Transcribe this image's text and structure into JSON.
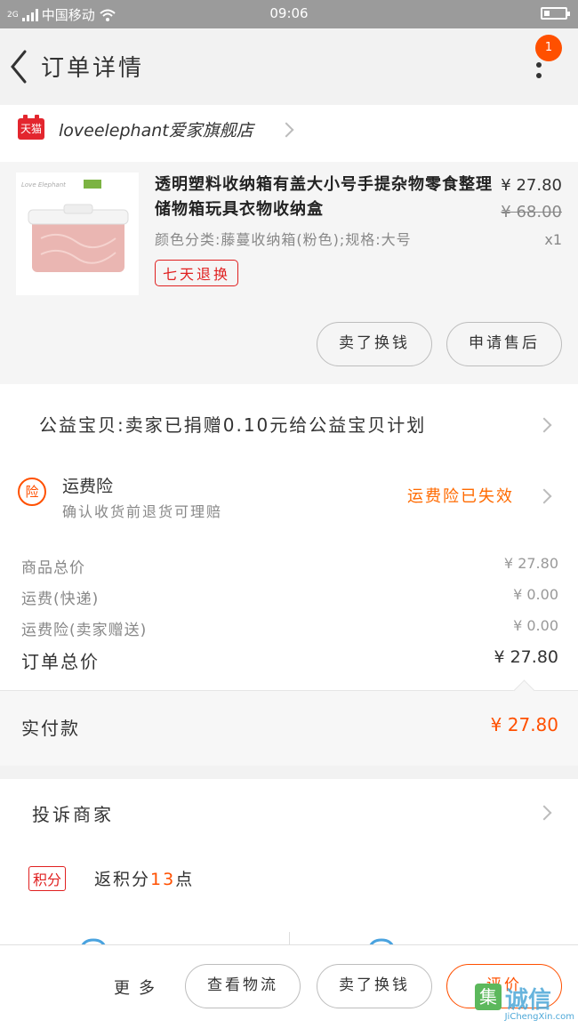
{
  "status_bar": {
    "network": "2G",
    "carrier": "中国移动",
    "time": "09:06"
  },
  "header": {
    "title": "订单详情",
    "badge_count": "1"
  },
  "shop": {
    "platform_badge": "天猫",
    "name": "loveelephant爱家旗舰店"
  },
  "product": {
    "title": "透明塑料收纳箱有盖大小号手提杂物零食整理储物箱玩具衣物收纳盒",
    "sku": "颜色分类:藤蔓收纳箱(粉色);规格:大号",
    "price": "¥ 27.80",
    "original_price": "¥ 68.00",
    "quantity": "x1",
    "tag": "七天退换",
    "image_brand": "Love Elephant",
    "buttons": {
      "buy_again": "卖了换钱",
      "after_sale": "申请售后"
    }
  },
  "charity": {
    "text": "公益宝贝:卖家已捐赠0.10元给公益宝贝计划"
  },
  "insurance": {
    "icon": "险",
    "title": "运费险",
    "description": "确认收货前退货可理赔",
    "status": "运费险已失效"
  },
  "summary": {
    "rows": [
      {
        "label": "商品总价",
        "value": "¥ 27.80"
      },
      {
        "label": "运费(快递)",
        "value": "¥ 0.00"
      },
      {
        "label": "运费险(卖家赠送)",
        "value": "¥ 0.00"
      }
    ],
    "total_label": "订单总价",
    "total_value": "¥ 27.80",
    "paid_label": "实付款",
    "paid_value": "¥ 27.80"
  },
  "extras": {
    "complain": "投诉商家",
    "points_badge": "积分",
    "points_prefix": "返积分",
    "points_value": "13",
    "points_suffix": "点"
  },
  "bottom_bar": {
    "more": "更多",
    "logistics": "查看物流",
    "buy_again": "卖了换钱",
    "review": "评价"
  },
  "watermark": {
    "text": "诚信",
    "url": "JiChengXin.com"
  },
  "colors": {
    "accent": "#ff5000",
    "tmall_red": "#e3262e",
    "status_bar": "#9b9b9b"
  }
}
